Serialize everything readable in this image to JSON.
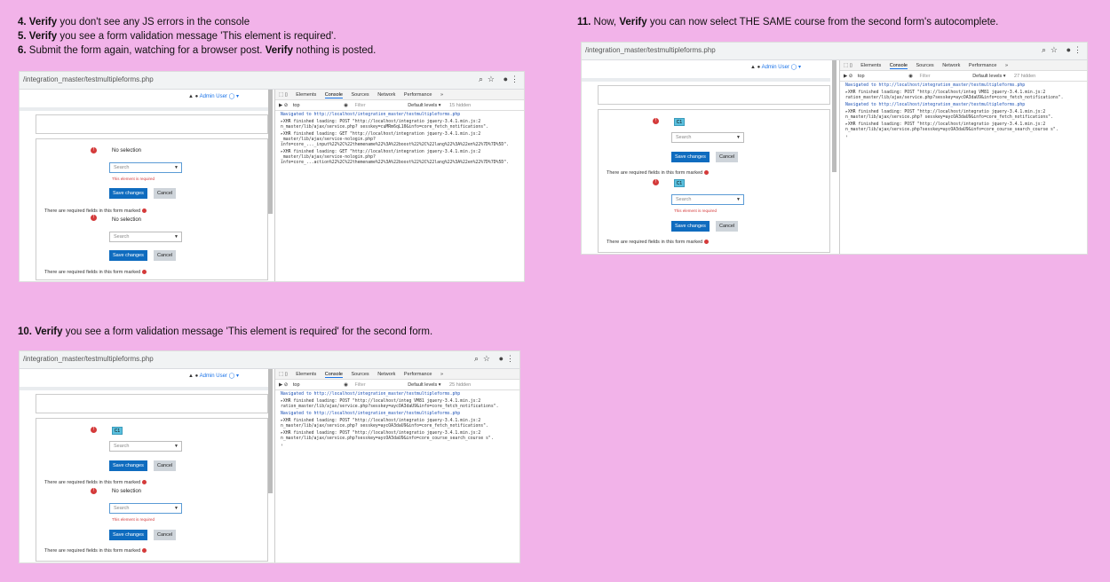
{
  "steps": {
    "s4": {
      "num": "4.",
      "verb": "Verify",
      "text": " you don't see any JS errors in the console"
    },
    "s5": {
      "num": "5.",
      "verb": "Verify",
      "text": " you see a form validation message 'This element is required'."
    },
    "s6": {
      "num": "6.",
      "pre": " Submit the form again, watching for a browser post. ",
      "verb": "Verify",
      "text": " nothing is posted."
    },
    "s10": {
      "num": "10.",
      "verb": "Verify",
      "text": " you see a form validation message 'This element is required' for the second form."
    },
    "s11": {
      "num": "11.",
      "pre": " Now, ",
      "verb": "Verify",
      "text": " you can now select THE SAME course from the second form's autocomplete."
    }
  },
  "browser": {
    "url": "/integration_master/testmultipleforms.php",
    "user": "Admin User"
  },
  "form": {
    "no_selection": "No selection",
    "search_placeholder": "Search",
    "error": "This element is required",
    "save": "Save changes",
    "cancel": "Cancel",
    "required_note": "There are required fields in this form marked",
    "chip": "C1"
  },
  "devtools": {
    "tabs": [
      "Elements",
      "Console",
      "Sources",
      "Network",
      "Performance",
      "»"
    ],
    "context": "top",
    "filter": "Filter",
    "levels": "Default levels ▾",
    "hidden_a": "15 hidden",
    "hidden_b": "25 hidden",
    "hidden_c": "27 hidden",
    "logs_a": [
      "Navigated to http://localhost/integration_master/testmultipleforms.php",
      "▸XHR finished loading: POST \"http://localhost/integratio jquery-3.4.1.min.js:2 n_master/lib/ajax/service.php? sesskey=cuMRm6qL10&info=core_fetch_notifications\".",
      "▸XHR finished loading: GET \"http://localhost/integration jquery-3.4.1.min.js:2 _master/lib/ajax/service-nologin.php?info=core_..._input%22%2C%22themename%22%3A%22boost%22%2C%22lang%22%3A%22en%22%7D%7D%5D\".",
      "▸XHR finished loading: GET \"http://localhost/integration jquery-3.4.1.min.js:2 _master/lib/ajax/service-nologin.php?info=core_...action%22%2C%22themename%22%3A%22boost%22%2C%22lang%22%3A%22en%22%7D%7D%5D\"."
    ],
    "logs_b": [
      "Navigated to http://localhost/integration_master/testmultipleforms.php",
      "▸XHR finished loading: POST \"http://localhost/integ VM81 jquery-3.4.1.min.js:2 ration_master/lib/ajax/service.php?sesskey=aycOA3daU9&info=core_fetch_notifications\".",
      "Navigated to http://localhost/integration_master/testmultipleforms.php",
      "▸XHR finished loading: POST \"http://localhost/integratio jquery-3.4.1.min.js:2 n_master/lib/ajax/service.php? sesskey=aycOA3daU9&info=core_fetch_notifications\".",
      "▸XHR finished loading: POST \"http://localhost/integratio jquery-3.4.1.min.js:2 n_master/lib/ajax/service.php?sesskey=aycOA3daU9&info=core_course_search_course s\"."
    ]
  }
}
